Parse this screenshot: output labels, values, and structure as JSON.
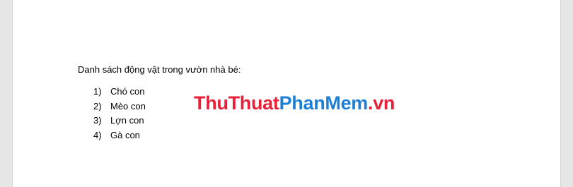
{
  "document": {
    "heading": "Danh sách động vật trong vườn nhà bé:",
    "items": [
      {
        "number": "1)",
        "text": "Chó con"
      },
      {
        "number": "2)",
        "text": "Mèo con"
      },
      {
        "number": "3)",
        "text": "Lợn con"
      },
      {
        "number": "4)",
        "text": "Gà con"
      }
    ]
  },
  "watermark": {
    "part1": "ThuThuat",
    "part2": "PhanMem",
    "part3": ".vn",
    "colors": {
      "red": "#e8213a",
      "blue": "#1e7fd6"
    }
  }
}
